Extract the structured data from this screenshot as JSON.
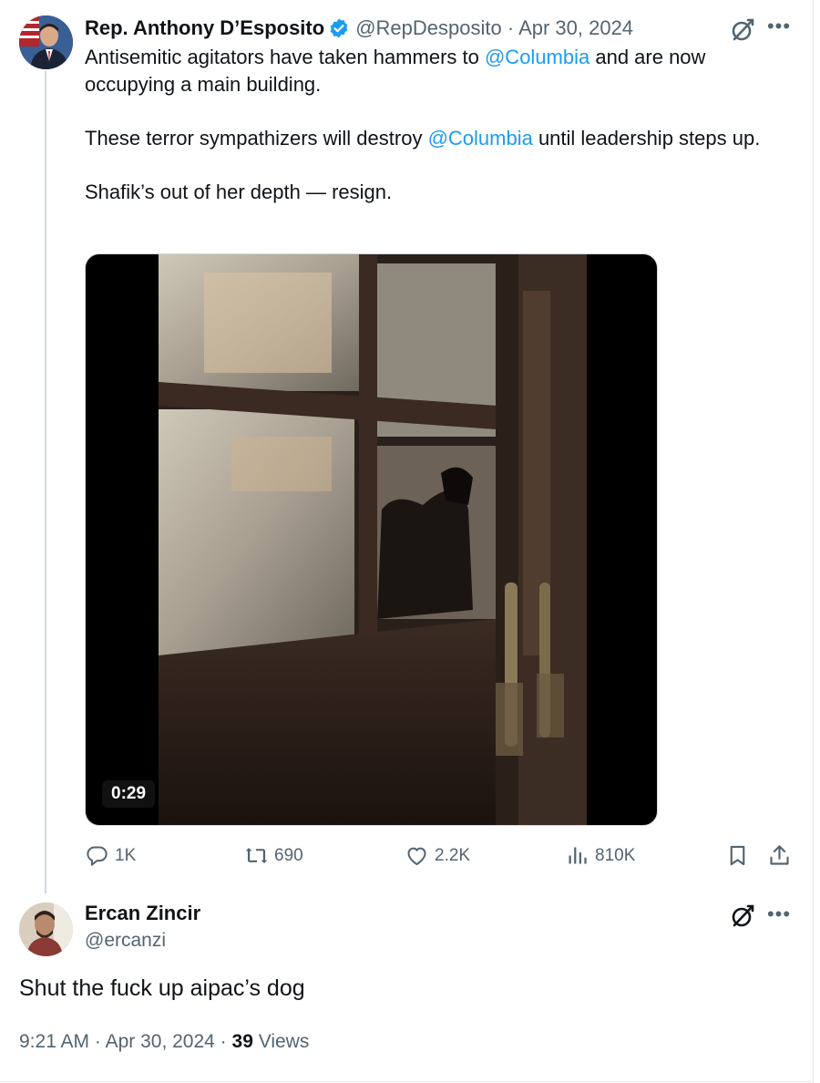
{
  "tweet": {
    "author_name": "Rep. Anthony D’Esposito",
    "handle": "@RepDesposito",
    "separator": " · ",
    "date": "Apr 30, 2024",
    "text": {
      "p1_a": "Antisemitic agitators have taken hammers to ",
      "mention1": "@Columbia",
      "p1_b": " and are now occupying a main building.",
      "p2_a": "These terror sympathizers will destroy ",
      "mention2": "@Columbia",
      "p2_b": " until leadership steps up.",
      "p3": "Shafik’s out of her depth — resign."
    },
    "video_duration": "0:29",
    "stats": {
      "replies": "1K",
      "retweets": "690",
      "likes": "2.2K",
      "views": "810K"
    }
  },
  "reply": {
    "author_name": "Ercan Zincir",
    "handle": "@ercanzi",
    "text": "Shut the fuck up aipac’s dog",
    "time": "9:21 AM",
    "sep1": " · ",
    "date": "Apr 30, 2024",
    "sep2": " · ",
    "views_count": "39",
    "views_label": " Views"
  },
  "icons": {
    "verified": "verified-badge-icon",
    "grok": "grok-icon",
    "more": "more-icon",
    "reply": "reply-icon",
    "retweet": "retweet-icon",
    "like": "like-icon",
    "views": "views-icon",
    "bookmark": "bookmark-icon",
    "share": "share-icon"
  },
  "colors": {
    "accent": "#1d9bf0",
    "text": "#0f1419",
    "secondary": "#536471",
    "border": "#cfd9de"
  }
}
